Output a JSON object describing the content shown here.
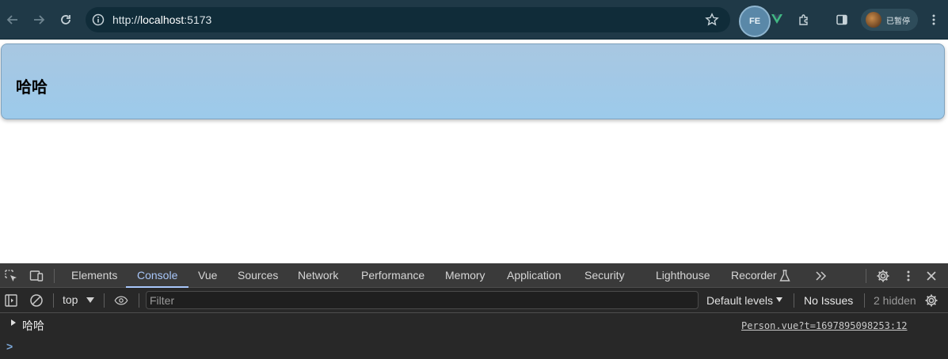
{
  "browser": {
    "url_scheme": "http://",
    "url_host": "localhost",
    "url_port": ":5173",
    "extension_badge": "FE",
    "profile_label": "已暂停"
  },
  "page": {
    "card_heading": "哈哈"
  },
  "devtools": {
    "tabs": [
      "Elements",
      "Console",
      "Vue",
      "Sources",
      "Network",
      "Performance",
      "Memory",
      "Application",
      "Security",
      "Lighthouse",
      "Recorder"
    ],
    "active_tab": "Console",
    "context": "top",
    "filter_placeholder": "Filter",
    "default_levels": "Default levels",
    "issues": "No Issues",
    "hidden": "2 hidden",
    "log_message": "哈哈",
    "log_source": "Person.vue?t=1697895098253:12",
    "prompt": ">"
  },
  "colors": {
    "toolbar_bg": "#1f3947",
    "card_bg": "#9ccaeb",
    "devtools_bg": "#282828",
    "active_tab": "#a8c7fa"
  }
}
